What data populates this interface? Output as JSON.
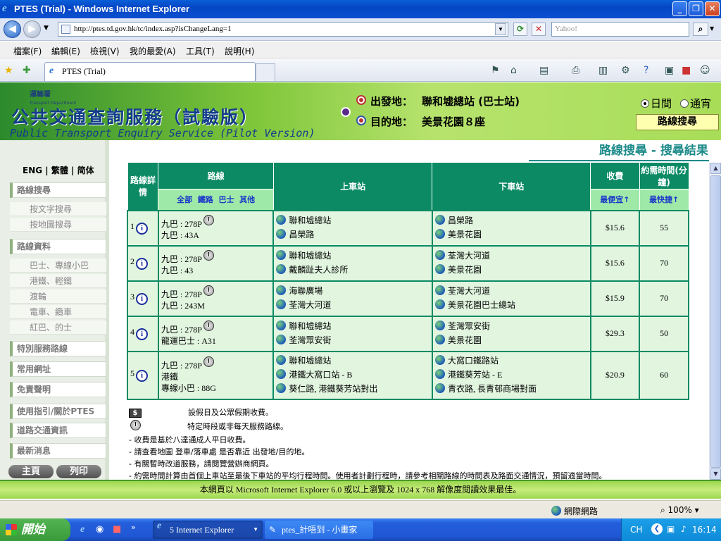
{
  "window": {
    "title": "PTES (Trial) - Windows Internet Explorer"
  },
  "browser": {
    "url": "http://ptes.td.gov.hk/tc/index.asp?isChangeLang=1",
    "search_placeholder": "Yahoo!",
    "menu": [
      "檔案(F)",
      "編輯(E)",
      "檢視(V)",
      "我的最愛(A)",
      "工具(T)",
      "說明(H)"
    ],
    "tab_title": "PTES (Trial)"
  },
  "header": {
    "logo_text": "運輸署",
    "logo_sub": "Transport Department",
    "title_zh": "公共交通查詢服務（試驗版）",
    "title_en": "Public Transport Enquiry Service (Pilot Version)",
    "origin_label": "出發地：",
    "origin_value": "聯和墟總站 (巴士站)",
    "dest_label": "目的地：",
    "dest_value": "美景花園８座",
    "period_day": "日間",
    "period_night": "通宵",
    "route_search_btn": "路線搜尋"
  },
  "nav": {
    "lang_eng": "ENG",
    "lang_tc": "繁體",
    "lang_sc": "简体",
    "items": {
      "route_search": "路線搜尋",
      "by_text": "按文字搜尋",
      "by_map": "按地圖搜尋",
      "route_info": "路線資料",
      "bus_minibus": "巴士、專線小巴",
      "rail": "港鐵、輕鐵",
      "ferry": "渡輪",
      "tram_peak": "電車、纜車",
      "red_minibus_taxi": "紅巴、的士",
      "special": "特別服務路線",
      "links": "常用網址",
      "disclaimer": "免責聲明",
      "guide": "使用指引/關於PTES",
      "traffic": "道路交通資訊",
      "news": "最新消息"
    },
    "home_btn": "主頁",
    "print_btn": "列印"
  },
  "results": {
    "title": "路線搜尋 - 搜尋結果",
    "headers": {
      "detail": "路線詳情",
      "route": "路線",
      "filter_all": "全部",
      "filter_rail": "鐵路",
      "filter_bus": "巴士",
      "filter_other": "其他",
      "board": "上車站",
      "alight": "下車站",
      "fare": "收費",
      "time": "約需時間(分鐘)",
      "cheapest": "最便宜",
      "fastest": "最快捷"
    },
    "rows": [
      {
        "idx": "1",
        "routes": [
          "九巴 : 278P",
          "九巴 : 43A"
        ],
        "board": [
          "聯和墟總站",
          "昌榮路"
        ],
        "alight": [
          "昌榮路",
          "美景花園"
        ],
        "fare": "$15.6",
        "time": "55"
      },
      {
        "idx": "2",
        "routes": [
          "九巴 : 278P",
          "九巴 : 43"
        ],
        "board": [
          "聯和墟總站",
          "戴麟趾夫人診所"
        ],
        "alight": [
          "荃灣大河道",
          "美景花園"
        ],
        "fare": "$15.6",
        "time": "70"
      },
      {
        "idx": "3",
        "routes": [
          "九巴 : 278P",
          "九巴 : 243M"
        ],
        "board": [
          "海聯廣場",
          "荃灣大河道"
        ],
        "alight": [
          "荃灣大河道",
          "美景花園巴士總站"
        ],
        "fare": "$15.9",
        "time": "70"
      },
      {
        "idx": "4",
        "routes": [
          "九巴 : 278P",
          "龍運巴士 : A31"
        ],
        "board": [
          "聯和墟總站",
          "荃灣眾安街"
        ],
        "alight": [
          "荃灣眾安街",
          "美景花園"
        ],
        "fare": "$29.3",
        "time": "50"
      },
      {
        "idx": "5",
        "routes": [
          "九巴 : 278P",
          "港鐵",
          "專線小巴 : 88G"
        ],
        "board": [
          "聯和墟總站",
          "港鐵大窩口站 - B",
          "葵仁路, 港鐵葵芳站對出"
        ],
        "alight": [
          "大窩口鐵路站",
          "港鐵葵芳站 - E",
          "青衣路, 長青邨商場對面"
        ],
        "fare": "$20.9",
        "time": "60"
      }
    ],
    "legend_dollar": "設假日及公眾假期收費。",
    "legend_clock": "特定時段或非每天服務路線。",
    "notes": [
      "- 收費是基於八達通成人平日收費。",
      "- 請查看地圖 登車/落車處 是否靠近 出發地/目的地。",
      "- 有關暫時改道服務，請閱覽營辦商網頁。",
      "- 約需時間計算由首個上車站至最後下車站的平均行程時間。使用者計劃行程時，請參考相關路線的時間表及路面交通情況，預留適當時間。"
    ]
  },
  "footer": {
    "text": "本網頁以 Microsoft Internet Explorer 6.0 或以上瀏覽及 1024 x 768 解像度閱讀效果最佳。"
  },
  "status": {
    "zone": "網際網路",
    "zoom": "100%"
  },
  "taskbar": {
    "start": "開始",
    "task1": "5 Internet Explorer",
    "task2": "ptes_計唔到 - 小畫家",
    "lang": "CH",
    "clock": "16:14"
  },
  "colors": {
    "header_green": "#7fc63a",
    "table_header": "#0b8a64",
    "row_bg": "#e1f5df",
    "title_teal": "#1e8a8a"
  }
}
